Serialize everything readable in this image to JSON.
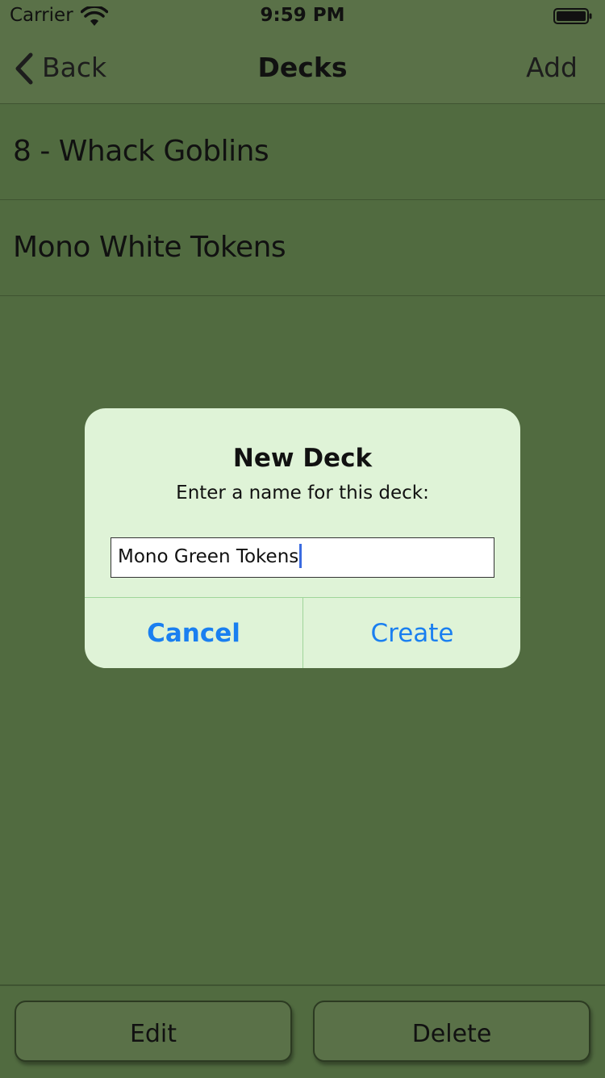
{
  "status_bar": {
    "carrier": "Carrier",
    "time": "9:59 PM",
    "icons": [
      "wifi-icon",
      "battery-icon"
    ]
  },
  "nav": {
    "back_label": "Back",
    "title": "Decks",
    "add_label": "Add",
    "icons": [
      "chevron-left-icon"
    ]
  },
  "decks": [
    {
      "name": "8 - Whack Goblins"
    },
    {
      "name": "Mono White Tokens"
    }
  ],
  "dialog": {
    "title": "New Deck",
    "message": "Enter a name for this deck:",
    "input_value": "Mono Green Tokens",
    "cancel_label": "Cancel",
    "create_label": "Create"
  },
  "toolbar": {
    "edit_label": "Edit",
    "delete_label": "Delete"
  },
  "colors": {
    "background": "#516b40",
    "bar": "#5a7148",
    "dialog_bg": "#dff3d7",
    "accent_blue": "#1a7ff0",
    "caret": "#3b6be0"
  }
}
